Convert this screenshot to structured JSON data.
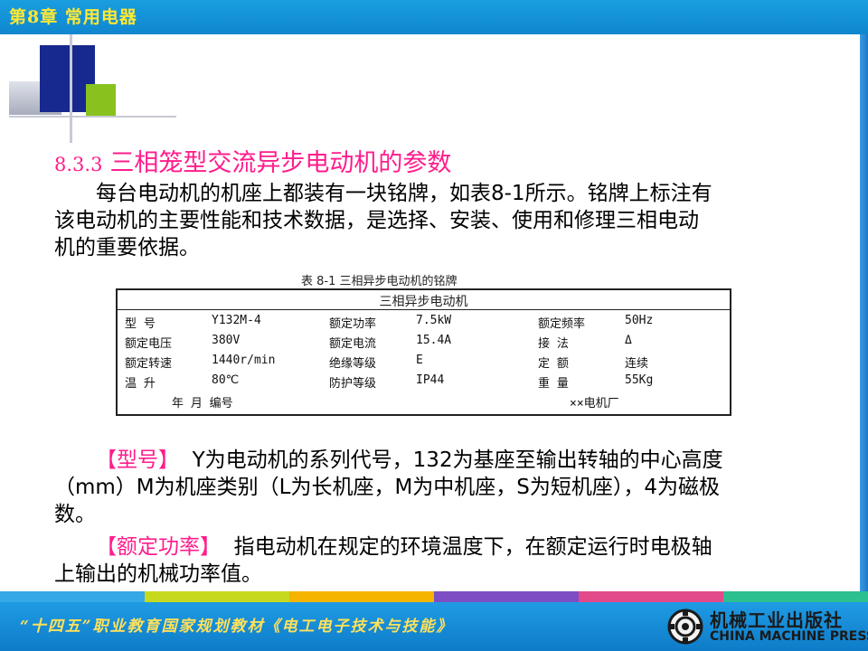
{
  "header": {
    "chapter_title": "第8章  常用电器"
  },
  "section": {
    "number": "8.3.3",
    "title": "三相笼型交流异步电动机的参数"
  },
  "intro": {
    "line1": "每台电动机的机座上都装有一块铭牌，如表8-1所示。铭牌上标注有",
    "line2": "该电动机的主要性能和技术数据，是选择、安装、使用和修理三相电动",
    "line3": "机的重要依据。"
  },
  "nameplate": {
    "caption": "表 8-1  三相异步电动机的铭牌",
    "title": "三相异步电动机",
    "rows": [
      {
        "l1": "型    号",
        "v1": "Y132M-4",
        "l2": "额定功率",
        "v2": "7.5kW",
        "l3": "额定频率",
        "v3": "50Hz"
      },
      {
        "l1": "额定电压",
        "v1": "380V",
        "l2": "额定电流",
        "v2": "15.4A",
        "l3": "接    法",
        "v3": "Δ"
      },
      {
        "l1": "额定转速",
        "v1": "1440r/min",
        "l2": "绝缘等级",
        "v2": "E",
        "l3": "定    额",
        "v3": "连续"
      },
      {
        "l1": "温    升",
        "v1": "80℃",
        "l2": "防护等级",
        "v2": "IP44",
        "l3": "重    量",
        "v3": "55Kg"
      }
    ],
    "footer_date": "年    月    编号",
    "footer_maker": "××电机厂"
  },
  "model_para": {
    "term": "【型号】",
    "line1": "Y为电动机的系列代号，132为基座至输出转轴的中心高度",
    "line2": "（mm）M为机座类别（L为长机座，M为中机座，S为短机座），4为磁极",
    "line3": "数。"
  },
  "power_para": {
    "term": "【额定功率】",
    "line1": "指电动机在规定的环境温度下，在额定运行时电极轴",
    "line2": "上输出的机械功率值。"
  },
  "footer": {
    "series": "“十四五”职业教育国家规划教材《电工电子技术与技能》",
    "publisher_cn": "机械工业出版社",
    "publisher_en": "CHINA MACHINE PRESS"
  },
  "colors": {
    "heading_pink": "#ff1d8c",
    "header_blue": "#1391d8",
    "chapter_yellow": "#ffe833",
    "stripe": [
      "#35a8e6",
      "#c7d91e",
      "#f4b400",
      "#7c4fc2",
      "#e24a8b",
      "#2cbf8f"
    ]
  }
}
